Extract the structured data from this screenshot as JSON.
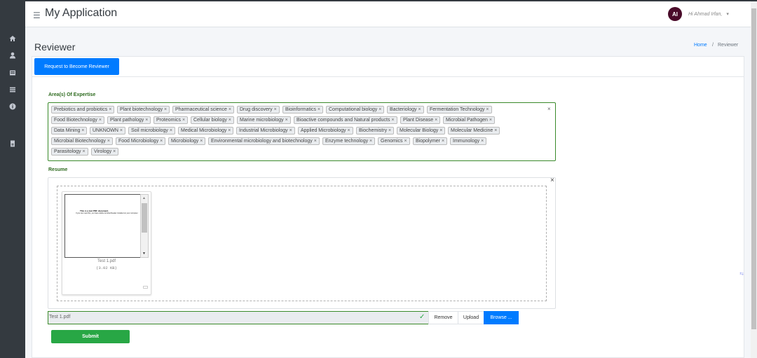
{
  "app": {
    "title": "My Application",
    "menu_icon": "hamburger-icon"
  },
  "user": {
    "initials": "AI",
    "greeting": "Hi Ahmad Irfan,",
    "caret": "▾"
  },
  "sidebar": {
    "items": [
      {
        "icon": "home-icon"
      },
      {
        "icon": "user-icon"
      },
      {
        "icon": "card-icon"
      },
      {
        "icon": "table-icon"
      },
      {
        "icon": "info-icon"
      },
      {
        "icon": "document-icon"
      }
    ]
  },
  "page": {
    "title": "Reviewer"
  },
  "breadcrumb": {
    "home": "Home",
    "separator": "/",
    "current": "Reviewer"
  },
  "actions": {
    "request_button": "Request to Become Reviewer"
  },
  "expertise": {
    "label": "Area(s) Of Expertise",
    "clear": "×",
    "tags": [
      "Prebiotics and probiotics",
      "Plant biotechnology",
      "Pharmaceutical science",
      "Drug discovery",
      "Bioinformatics",
      "Computational biology",
      "Bacteriology",
      "Fermentation Technology",
      "Food Biotechnology",
      "Plant pathology",
      "Proteomics",
      "Cellular biology",
      "Marine microbiology",
      "Bioactive compounds and Natural products",
      "Plant Disease",
      "Microbial Pathogen",
      "Data Mining",
      "UNKNOWN",
      "Soil microbiology",
      "Medical Microbiology",
      "Industrial Microbiology",
      "Applied Microbiology",
      "Biochemistry",
      "Molecular Biology",
      "Molecular Medicine",
      "Microbial Biotechnology",
      "Food Microbiology",
      "Microbiology",
      "Environmental microbiology and biotechnology",
      "Enzyme technology",
      "Genomics",
      "Biopolymer",
      "Immunology",
      "Parasitology",
      "Virology"
    ]
  },
  "resume": {
    "label": "Resume",
    "close": "×",
    "file_name": "Test 1.pdf",
    "file_size": "(3.02 KB)",
    "preview_line1": "This is a test PDF document.",
    "preview_line2": "If you can read this, you have Adobe Acrobat Reader installed on your computer.",
    "input_value": "Test 1.pdf",
    "check": "✓",
    "remove": "Remove",
    "upload": "Upload",
    "browse": "Browse ..."
  },
  "submit": "Submit",
  "colors": {
    "primary": "#007bff",
    "success": "#28a745",
    "sidebar": "#343a40",
    "label_green": "#2e6b1f"
  }
}
